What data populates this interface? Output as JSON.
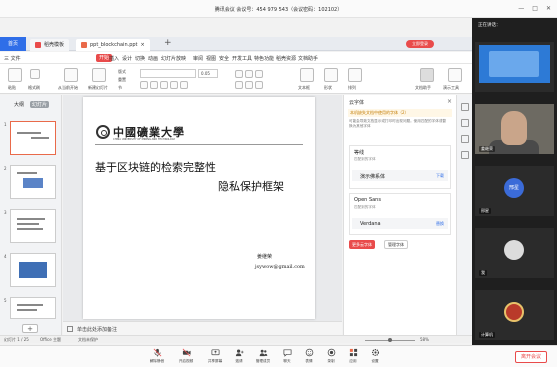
{
  "meeting": {
    "title": "腾讯会议 会议号：454 979 543（会议密码：102102）",
    "leave_label": "离开会议",
    "controls": [
      "解除静音",
      "开启视频",
      "共享屏幕",
      "邀请",
      "管理成员",
      "聊天",
      "表情",
      "录制",
      "应用",
      "设置"
    ]
  },
  "app": {
    "home_tab": "首页",
    "tabs": [
      {
        "label": "稻壳模板",
        "icon_color": "#e94b4b"
      },
      {
        "label": "ppt_blockchain.ppt",
        "icon_color": "#e96a4a"
      }
    ],
    "user_pill": "立即登录"
  },
  "menu": {
    "items": [
      "三 文件",
      "开始",
      "插入",
      "设计",
      "切换",
      "动画",
      "幻灯片放映",
      "审阅",
      "视图",
      "安全",
      "开发工具",
      "特色功能",
      "稻壳资源",
      "文档助手"
    ]
  },
  "toolbar": {
    "font_size_value": "0.05",
    "labels": [
      "粘贴",
      "格式刷",
      "从当前开始",
      "新建幻灯片",
      "版式",
      "重置",
      "节",
      "文本框",
      "形状",
      "排列",
      "文档助手",
      "演示工具"
    ]
  },
  "thumbnails": {
    "tabs": [
      "大纲",
      "幻灯片"
    ],
    "slide_numbers": [
      "1",
      "2",
      "3",
      "4",
      "5"
    ]
  },
  "slide": {
    "logo_text": "中國礦業大學",
    "logo_sub": "CHINA UNIVERSITY OF MINING AND TECHNOLOGY",
    "title_line1": "基于区块链的检索完整性",
    "title_line2": "隐私保护框架",
    "author": "姜继荣",
    "email": "jsywow@gmail.com"
  },
  "notes": {
    "placeholder": "单击此处添加备注"
  },
  "font_panel": {
    "title": "云字体",
    "warning": "本机缺失文档中使用的字体（2）",
    "note": "可能会导致文档显示或打印时出现问题。使用匹配的字体或替换为其他字体",
    "fonts": [
      {
        "name": "等线",
        "status": "匹配到的字体",
        "replacement": "演示佛系体",
        "action": "下载"
      },
      {
        "name": "Open Sans",
        "status": "匹配到的字体",
        "replacement": "Verdana",
        "action": "替换"
      }
    ],
    "primary_button": "更多云字体",
    "secondary_button": "管理字体"
  },
  "status": {
    "slide_info": "幻灯片 1 / 25",
    "theme": "Office 主题",
    "protect": "文档未保护",
    "zoom": "58%"
  },
  "gallery": {
    "header": "正在讲话：",
    "tiles": [
      {
        "name": "",
        "kind": "screen"
      },
      {
        "name": "姜继荣",
        "kind": "camera"
      },
      {
        "name": "邢星",
        "kind": "avatar",
        "avatar_color": "#3b6bd8",
        "avatar_text": "邢星"
      },
      {
        "name": "我",
        "kind": "avatar",
        "avatar_color": "#dcdcdc",
        "avatar_text": ""
      },
      {
        "name": "计算机",
        "kind": "avatar",
        "avatar_color": "#b93a2a",
        "avatar_text": ""
      }
    ]
  }
}
